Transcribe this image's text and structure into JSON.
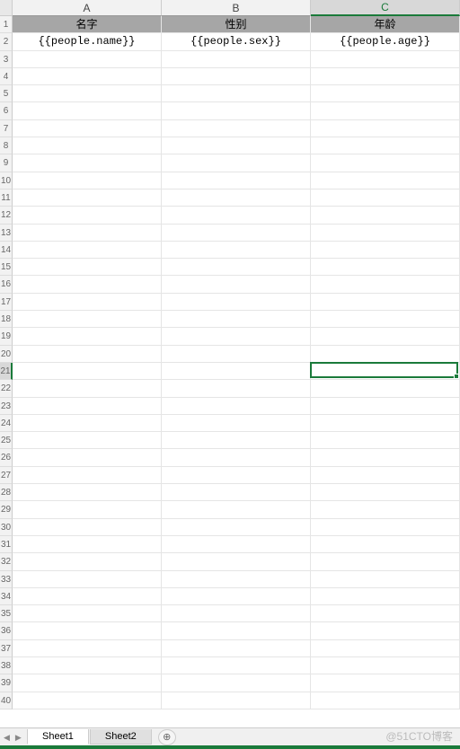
{
  "columns": [
    {
      "letter": "A",
      "selected": false
    },
    {
      "letter": "B",
      "selected": false
    },
    {
      "letter": "C",
      "selected": true
    }
  ],
  "header_row": {
    "values": [
      "名字",
      "性别",
      "年龄"
    ]
  },
  "data_row": {
    "values": [
      "{{people.name}}",
      "{{people.sex}}",
      "{{people.age}}"
    ]
  },
  "row_numbers_start": 1,
  "row_count": 40,
  "selected_cell": {
    "row": 21,
    "col": 2
  },
  "tabs": [
    {
      "label": "Sheet1",
      "active": true
    },
    {
      "label": "Sheet2",
      "active": false
    }
  ],
  "add_tab_glyph": "⊕",
  "nav": {
    "prev": "◀",
    "next": "▶"
  },
  "watermark": "@51CTO博客"
}
